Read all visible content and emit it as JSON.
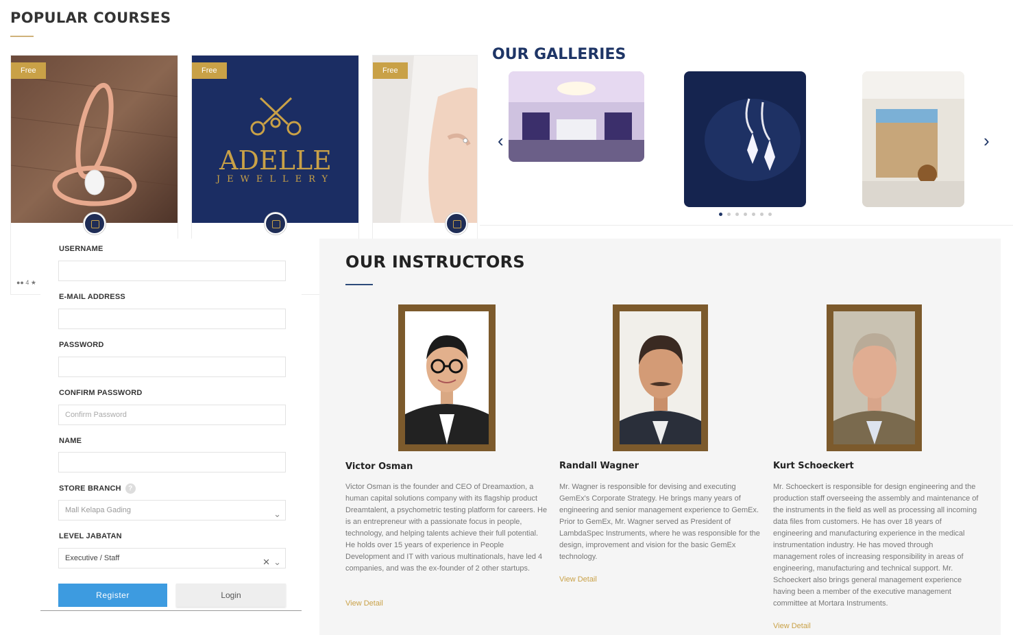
{
  "popular_courses": {
    "title": "POPULAR COURSES",
    "cards": [
      {
        "badge": "Free",
        "image": "rose-gold-diamond-ring-photo",
        "meta": "4"
      },
      {
        "badge": "Free",
        "image": "adelle-jewellery-logo",
        "brand_line1": "ADELLE",
        "brand_line2": "JEWELLERY"
      },
      {
        "badge": "Free",
        "image": "hand-with-ring-photo"
      }
    ]
  },
  "galleries": {
    "title": "OUR GALLERIES",
    "images": [
      "jewellery-store-interior",
      "diamond-earrings",
      "jewellery-kiosk"
    ],
    "dots": 7,
    "active_dot": 0
  },
  "instructors": {
    "title": "OUR INSTRUCTORS",
    "items": [
      {
        "name": "Victor Osman",
        "bio": "Victor Osman is the founder and CEO of Dreamaxtion, a human capital solutions company with its flagship product Dreamtalent, a psychometric testing platform for careers. He is an entrepreneur with a passionate focus in people, technology, and helping talents achieve their full potential. He holds over 15 years of experience in People Development and IT with various multinationals, have led 4 companies, and was the ex-founder of 2 other startups.",
        "link": "View Detail"
      },
      {
        "name": "Randall Wagner",
        "bio": "Mr. Wagner is responsible for devising and executing GemEx's Corporate Strategy. He brings many years of engineering and senior management experience to GemEx. Prior to GemEx, Mr. Wagner served as President of LambdaSpec Instruments, where he was responsible for the design, improvement and vision for the basic GemEx technology.",
        "link": "View Detail"
      },
      {
        "name": "Kurt Schoeckert",
        "bio": "Mr. Schoeckert is responsible for design engineering and the production staff overseeing the assembly and maintenance of the instruments in the field as well as processing all incoming data files from customers. He has over 18 years of engineering and manufacturing experience in the medical instrumentation industry. He has moved through management roles of increasing responsibility in areas of engineering, manufacturing and technical support. Mr. Schoeckert also brings general management experience having been a member of the executive management committee at Mortara Instruments.",
        "link": "View Detail"
      }
    ]
  },
  "register_form": {
    "username_label": "USERNAME",
    "username_value": "",
    "email_label": "E-MAIL ADDRESS",
    "email_value": "",
    "password_label": "PASSWORD",
    "password_value": "",
    "confirm_label": "CONFIRM PASSWORD",
    "confirm_placeholder": "Confirm Password",
    "name_label": "NAME",
    "name_value": "",
    "store_label": "STORE BRANCH",
    "store_help": "?",
    "store_value": "Mall Kelapa Gading",
    "level_label": "LEVEL JABATAN",
    "level_value": "Executive / Staff",
    "register_button": "Register",
    "login_button": "Login"
  },
  "colors": {
    "accent_gold": "#c9a147",
    "navy": "#1e3566",
    "frame_brown": "#7c5a2c",
    "register_blue": "#3d9be0"
  }
}
